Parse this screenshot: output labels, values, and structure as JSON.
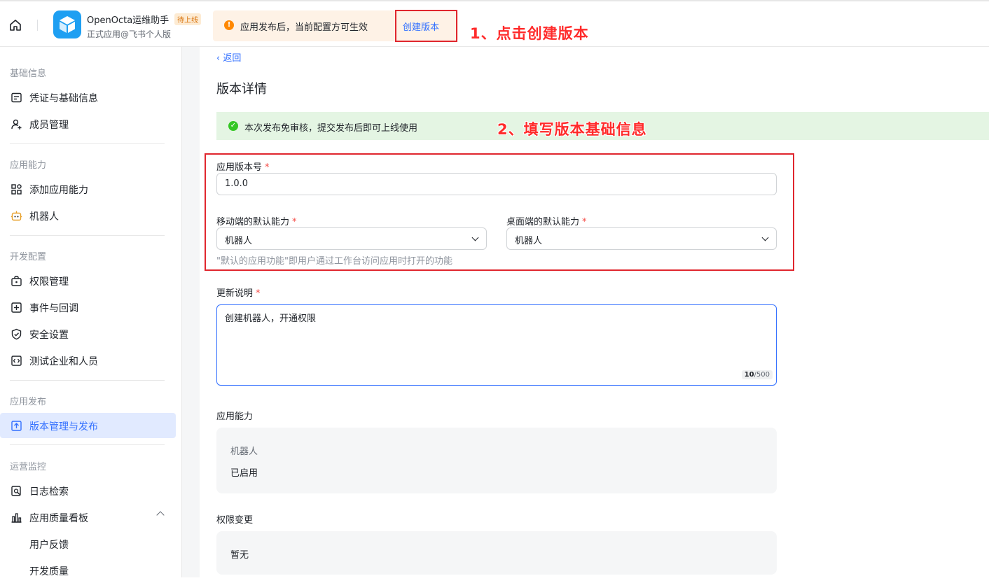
{
  "topbar": {
    "app_name": "OpenOcta运维助手",
    "app_tag": "待上线",
    "app_subtitle": "正式应用@飞书个人版",
    "notice_text": "应用发布后，当前配置方可生效",
    "create_version_label": "创建版本"
  },
  "annotations": {
    "step1": "1、点击创建版本",
    "step2": "2、填写版本基础信息"
  },
  "sidebar": {
    "sections": [
      {
        "title": "基础信息",
        "items": [
          {
            "label": "凭证与基础信息",
            "icon": "credential-icon"
          },
          {
            "label": "成员管理",
            "icon": "member-icon"
          }
        ]
      },
      {
        "title": "应用能力",
        "items": [
          {
            "label": "添加应用能力",
            "icon": "add-capability-icon"
          },
          {
            "label": "机器人",
            "icon": "robot-icon"
          }
        ]
      },
      {
        "title": "开发配置",
        "items": [
          {
            "label": "权限管理",
            "icon": "permission-icon"
          },
          {
            "label": "事件与回调",
            "icon": "event-icon"
          },
          {
            "label": "安全设置",
            "icon": "shield-icon"
          },
          {
            "label": "测试企业和人员",
            "icon": "test-icon"
          }
        ]
      },
      {
        "title": "应用发布",
        "items": [
          {
            "label": "版本管理与发布",
            "icon": "upload-icon",
            "active": true
          }
        ]
      },
      {
        "title": "运营监控",
        "items": [
          {
            "label": "日志检索",
            "icon": "log-search-icon"
          },
          {
            "label": "应用质量看板",
            "icon": "chart-icon"
          },
          {
            "label": "用户反馈"
          },
          {
            "label": "开发质量"
          }
        ]
      }
    ]
  },
  "main": {
    "back_label": "返回",
    "page_title": "版本详情",
    "success_text": "本次发布免审核，提交发布后即可上线使用",
    "version_label": "应用版本号",
    "version_value": "1.0.0",
    "mobile_label": "移动端的默认能力",
    "mobile_value": "机器人",
    "desktop_label": "桌面端的默认能力",
    "desktop_value": "机器人",
    "default_hint": "\"默认的应用功能\"即用户通过工作台访问应用时打开的功能",
    "release_notes_label": "更新说明",
    "release_notes_value": "创建机器人，开通权限",
    "counter_current": "10",
    "counter_max": "/500",
    "capability_label": "应用能力",
    "capability_name": "机器人",
    "capability_status": "已启用",
    "permission_label": "权限变更",
    "permission_value": "暂无"
  }
}
